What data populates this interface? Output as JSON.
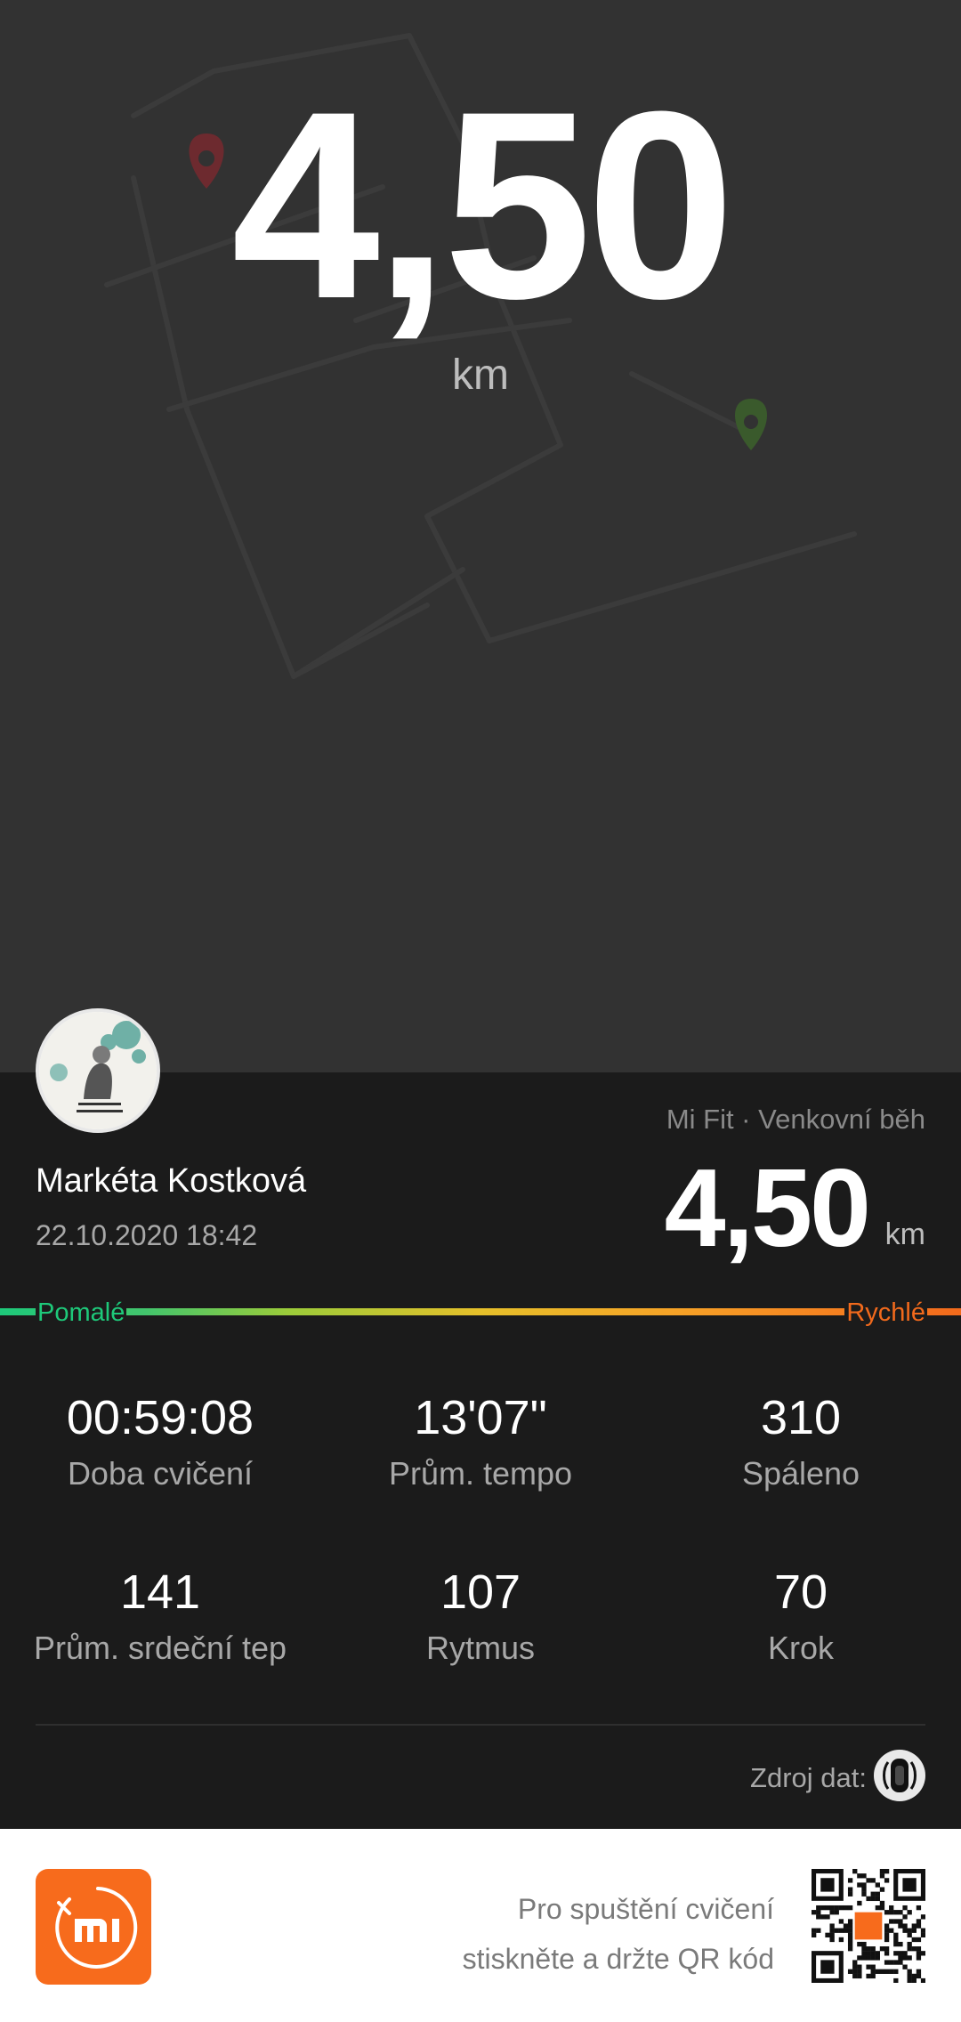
{
  "header": {
    "distance": "4,50",
    "unit": "km"
  },
  "profile": {
    "name": "Markéta Kostková",
    "datetime": "22.10.2020 18:42"
  },
  "workout": {
    "source": "Mi Fit · Venkovní běh",
    "distance": "4,50",
    "unit": "km"
  },
  "pace_scale": {
    "slow_label": "Pomalé",
    "fast_label": "Rychlé"
  },
  "stats": [
    {
      "value": "00:59:08",
      "label": "Doba cvičení"
    },
    {
      "value": "13'07\"",
      "label": "Prům. tempo"
    },
    {
      "value": "310",
      "label": "Spáleno"
    },
    {
      "value": "141",
      "label": "Prům. srdeční tep"
    },
    {
      "value": "107",
      "label": "Rytmus"
    },
    {
      "value": "70",
      "label": "Krok"
    }
  ],
  "data_source": {
    "label": "Zdroj dat:"
  },
  "footer": {
    "line1": "Pro spuštění cvičení",
    "line2": "stiskněte a držte QR kód"
  },
  "colors": {
    "slow": "#1ec97a",
    "fast": "#f26a1c",
    "brand": "#f76b1c"
  },
  "icons": [
    "start-pin-icon",
    "end-pin-icon",
    "band-icon",
    "mi-logo-icon",
    "qr-code"
  ]
}
